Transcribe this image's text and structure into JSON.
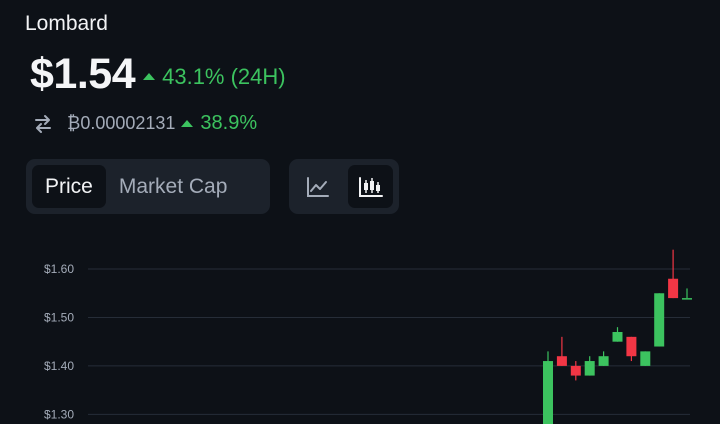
{
  "coin": {
    "name": "Lombard"
  },
  "price": {
    "value": "$1.54",
    "change": "43.1% (24H)",
    "direction": "up"
  },
  "btc": {
    "value": "₿0.00002131",
    "change": "38.9%",
    "direction": "up"
  },
  "tabs": [
    {
      "label": "Price",
      "active": true
    },
    {
      "label": "Market Cap",
      "active": false
    }
  ],
  "chart_toggle": [
    {
      "icon": "line-chart-icon",
      "active": false
    },
    {
      "icon": "candlestick-chart-icon",
      "active": true
    }
  ],
  "colors": {
    "up": "#3cc35f",
    "down": "#f23645",
    "background": "#0d1117",
    "panel": "#1c222b"
  },
  "chart_data": {
    "type": "candlestick",
    "ylim": [
      1.28,
      1.66
    ],
    "yticks": [
      {
        "value": 1.6,
        "label": "$1.60"
      },
      {
        "value": 1.5,
        "label": "$1.50"
      },
      {
        "value": 1.4,
        "label": "$1.40"
      },
      {
        "value": 1.3,
        "label": "$1.30"
      }
    ],
    "candles": [
      {
        "open": 1.28,
        "close": 1.41,
        "high": 1.43,
        "low": 1.28
      },
      {
        "open": 1.42,
        "close": 1.4,
        "high": 1.46,
        "low": 1.4
      },
      {
        "open": 1.4,
        "close": 1.38,
        "high": 1.41,
        "low": 1.37
      },
      {
        "open": 1.38,
        "close": 1.41,
        "high": 1.42,
        "low": 1.38
      },
      {
        "open": 1.4,
        "close": 1.42,
        "high": 1.43,
        "low": 1.4
      },
      {
        "open": 1.45,
        "close": 1.47,
        "high": 1.48,
        "low": 1.45
      },
      {
        "open": 1.46,
        "close": 1.42,
        "high": 1.46,
        "low": 1.41
      },
      {
        "open": 1.4,
        "close": 1.43,
        "high": 1.43,
        "low": 1.4
      },
      {
        "open": 1.44,
        "close": 1.55,
        "high": 1.55,
        "low": 1.44
      },
      {
        "open": 1.58,
        "close": 1.54,
        "high": 1.64,
        "low": 1.54
      },
      {
        "open": 1.54,
        "close": 1.54,
        "high": 1.56,
        "low": 1.54
      }
    ]
  }
}
